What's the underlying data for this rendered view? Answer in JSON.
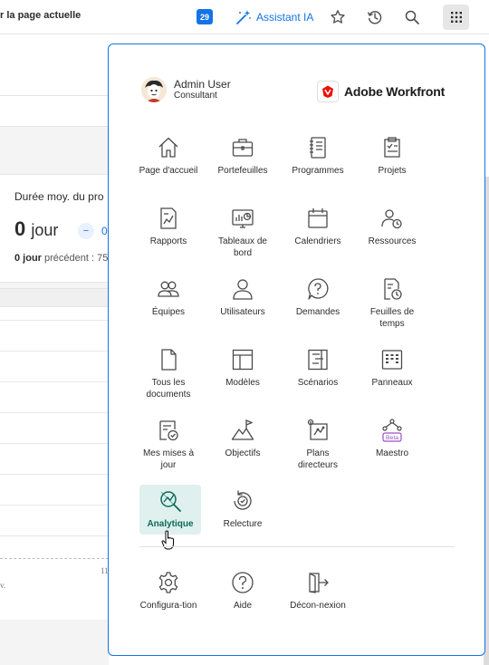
{
  "topbar": {
    "breadcrumb": "r la page actuelle",
    "notification_count": "29",
    "assistant_label": "Assistant IA",
    "icons": [
      "notification-badge",
      "sparkle-wand-icon",
      "star-icon",
      "history-icon",
      "search-icon",
      "app-grid-icon"
    ]
  },
  "background": {
    "card_title": "Durée moy. du pro",
    "card_value_number": "0",
    "card_value_unit": "jour",
    "card_pill": "−",
    "card_pill_number": "0",
    "card_sub_value": "0 jour",
    "card_sub_text": " précédent : 75",
    "axis_tick": "11",
    "axis_label": "v."
  },
  "menu": {
    "user_name": "Admin User",
    "user_role": "Consultant",
    "brand": "Adobe Workfront",
    "items": [
      {
        "label": "Page d'accueil",
        "icon": "home-icon"
      },
      {
        "label": "Portefeuilles",
        "icon": "briefcase-icon"
      },
      {
        "label": "Programmes",
        "icon": "notebook-icon"
      },
      {
        "label": "Projets",
        "icon": "clipboard-check-icon"
      },
      {
        "label": "Rapports",
        "icon": "report-icon"
      },
      {
        "label": "Tableaux de bord",
        "icon": "dashboard-icon"
      },
      {
        "label": "Calendriers",
        "icon": "calendar-icon"
      },
      {
        "label": "Ressources",
        "icon": "resources-icon"
      },
      {
        "label": "Équipes",
        "icon": "teams-icon"
      },
      {
        "label": "Utilisateurs",
        "icon": "user-icon"
      },
      {
        "label": "Demandes",
        "icon": "question-bubble-icon"
      },
      {
        "label": "Feuilles de temps",
        "icon": "timesheet-icon"
      },
      {
        "label": "Tous les documents",
        "icon": "document-icon"
      },
      {
        "label": "Modèles",
        "icon": "template-icon"
      },
      {
        "label": "Scénarios",
        "icon": "scenario-icon"
      },
      {
        "label": "Panneaux",
        "icon": "boards-icon"
      },
      {
        "label": "Mes mises à jour",
        "icon": "updates-icon"
      },
      {
        "label": "Objectifs",
        "icon": "goals-icon"
      },
      {
        "label": "Plans directeurs",
        "icon": "blueprint-icon"
      },
      {
        "label": "Maestro",
        "icon": "maestro-icon",
        "badge": "Beta"
      },
      {
        "label": "Analytique",
        "icon": "analytics-icon",
        "active": true
      },
      {
        "label": "Relecture",
        "icon": "proof-icon"
      }
    ],
    "footer_items": [
      {
        "label": "Configura-tion",
        "icon": "gear-icon"
      },
      {
        "label": "Aide",
        "icon": "help-icon"
      },
      {
        "label": "Décon-nexion",
        "icon": "logout-icon"
      }
    ]
  },
  "colors": {
    "accent": "#1473e6",
    "active_bg": "#dff0ee",
    "active_text": "#0b6b5a",
    "beta": "#9a4fc9"
  }
}
